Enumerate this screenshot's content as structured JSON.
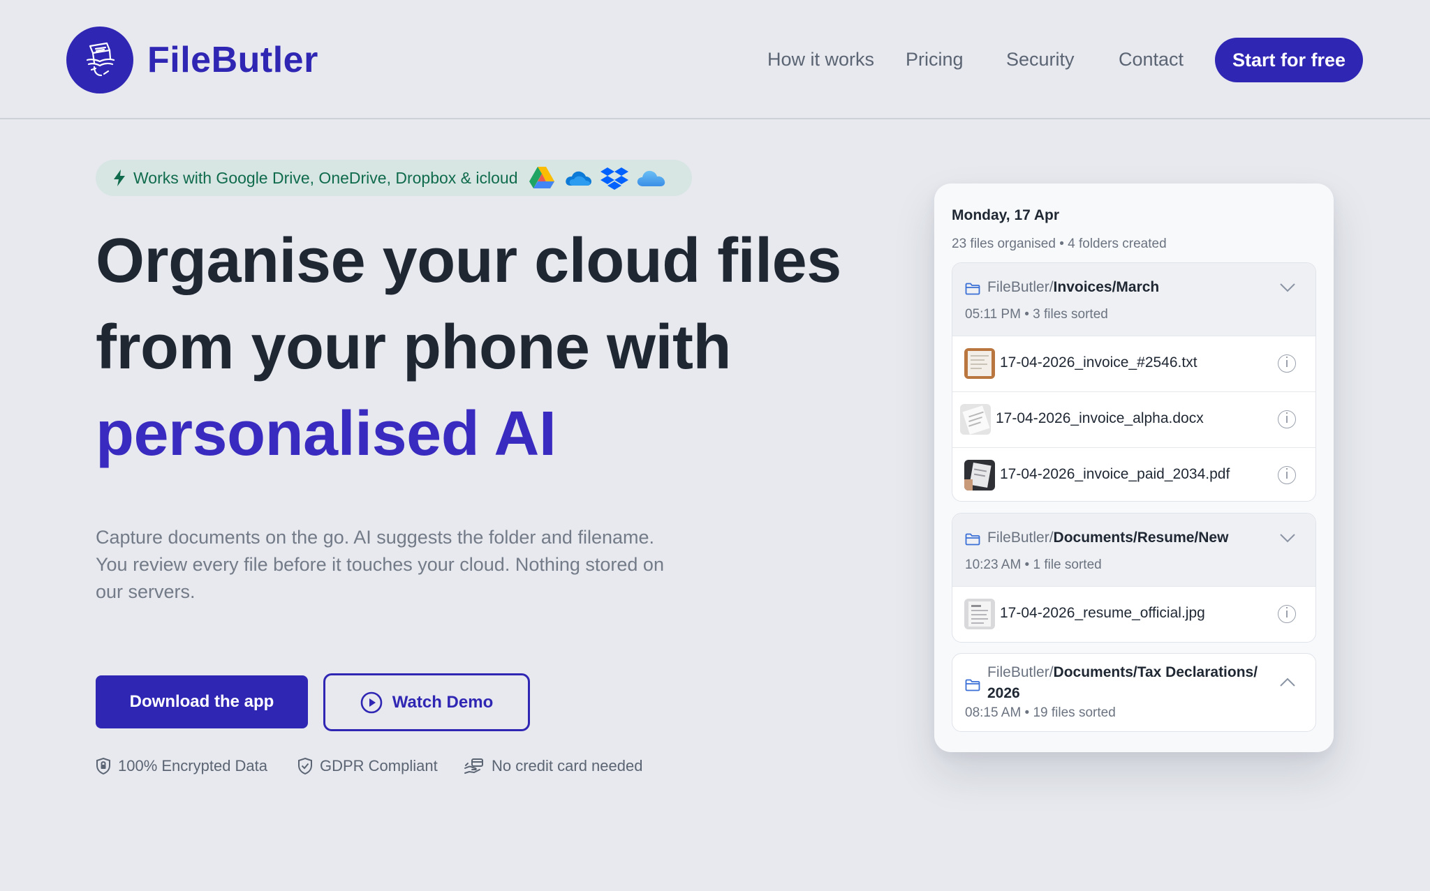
{
  "header": {
    "brand": "FileButler",
    "nav": [
      "How it works",
      "Pricing",
      "Security",
      "Contact"
    ],
    "cta": "Start for free"
  },
  "hero": {
    "badge": "Works with Google Drive, OneDrive, Dropbox & icloud",
    "badge_icons": [
      "google-drive-icon",
      "onedrive-icon",
      "dropbox-icon",
      "icloud-icon"
    ],
    "headline": [
      "Organise your cloud files",
      "from your phone with"
    ],
    "headline_accent": "personalised AI",
    "subtext": "Capture documents on the go. AI suggests the folder and filename. You review every file before it touches your cloud. Nothing stored on our servers.",
    "primary_button": "Download the app",
    "secondary_button": "Watch Demo",
    "trust": [
      {
        "icon": "shield-lock-icon",
        "label": "100% Encrypted Data"
      },
      {
        "icon": "shield-check-icon",
        "label": "GDPR Compliant"
      },
      {
        "icon": "card-hand-icon",
        "label": "No credit card needed"
      }
    ]
  },
  "card": {
    "date": "Monday, 17 Apr",
    "stats": "23 files organised • 4 folders created",
    "groups": [
      {
        "prefix": "FileButler/",
        "path": "Invoices/March",
        "meta": "05:11 PM • 3 files sorted",
        "expanded": true,
        "files": [
          "17-04-2026_invoice_#2546.txt",
          "17-04-2026_invoice_alpha.docx",
          "17-04-2026_invoice_paid_2034.pdf"
        ]
      },
      {
        "prefix": "FileButler/",
        "path": "Documents/Resume/New",
        "meta": "10:23 AM • 1 file sorted",
        "expanded": true,
        "files": [
          "17-04-2026_resume_official.jpg"
        ]
      },
      {
        "prefix": "FileButler/",
        "path": "Documents/Tax Declarations/",
        "path_line2": "2026",
        "meta": "08:15 AM • 19 files sorted",
        "expanded": false,
        "files": []
      }
    ]
  },
  "colors": {
    "brand": "#3026b4",
    "accent_text": "#3a2bc0",
    "background": "#e7e9ee",
    "badge_bg": "#d7e6e3",
    "badge_text": "#0f6b4c"
  }
}
